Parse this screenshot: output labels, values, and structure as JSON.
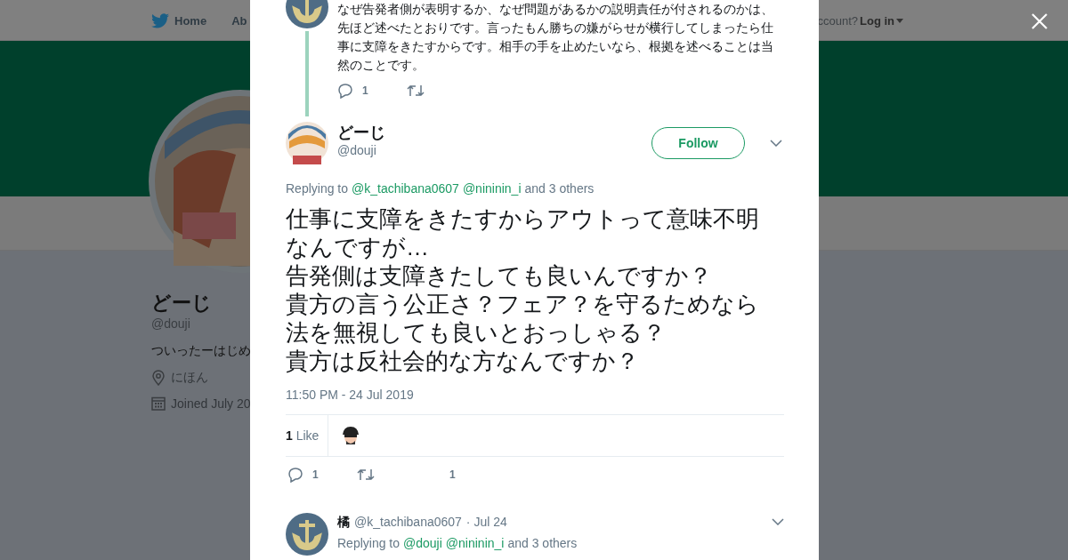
{
  "background_page": {
    "nav": {
      "items": [
        {
          "label": "Home",
          "kind": "home"
        },
        {
          "label": "Ab",
          "kind": "plain"
        }
      ],
      "account_prompt": "ccount?",
      "login": "Log in"
    },
    "profile": {
      "name": "どーじ",
      "handle": "@douji",
      "bio": "ついったーはじめ",
      "location": "にほん",
      "joined": "Joined July 20"
    }
  },
  "modal": {
    "parent_tweet": {
      "text_lines": [
        "なぜ告発者側が表明するか、なぜ問題があるかの説明責任が付されるのかは、",
        "先ほど述べたとおりです。言ったもん勝ちの嫌がらせが横行してしまったら仕",
        "事に支障をきたすからです。相手の手を止めたいなら、根拠を述べることは当",
        "然のことです。"
      ],
      "reply_count": "1"
    },
    "tweet": {
      "name": "どーじ",
      "handle": "@douji",
      "follow_button": "Follow",
      "replying_prefix": "Replying to",
      "mentions": [
        "@k_tachibana0607",
        "@nininin_i"
      ],
      "replying_suffix": "and 3 others",
      "text_lines": [
        "仕事に支障をきたすからアウトって意味不明",
        "なんですが…",
        "告発側は支障きたしても良いんですか？",
        "貴方の言う公正さ？フェア？を守るためなら",
        "法を無視しても良いとおっしゃる？",
        "貴方は反社会的な方なんですか？"
      ],
      "timestamp": "11:50 PM - 24 Jul 2019",
      "likes_count": "1",
      "likes_label": "Like",
      "reply_count": "1",
      "like_count": "1"
    },
    "reply": {
      "name": "橘",
      "handle": "@k_tachibana0607",
      "date": "· Jul 24",
      "replying_prefix": "Replying to",
      "mentions": [
        "@douji",
        "@nininin_i"
      ],
      "replying_suffix": "and 3 others"
    }
  }
}
